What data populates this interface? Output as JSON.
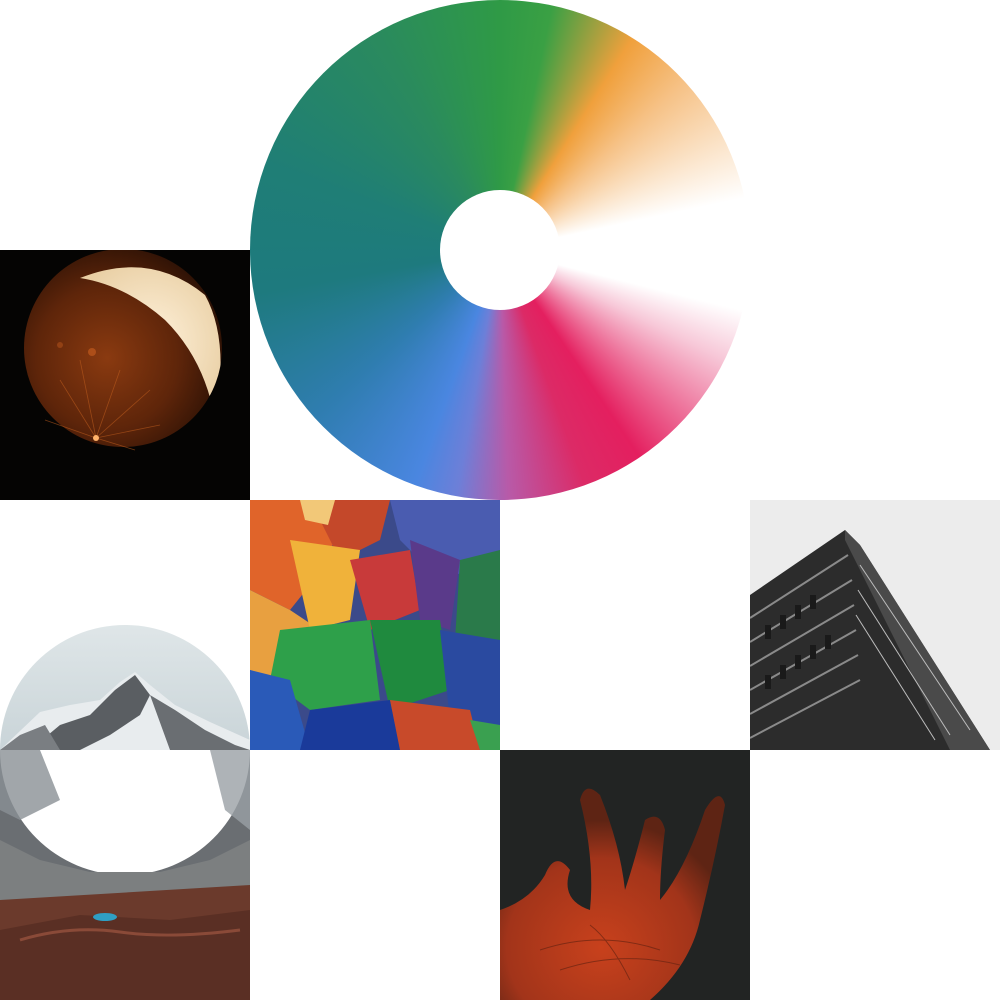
{
  "colors": {
    "background": "#ffffff",
    "moon_bg": "#050403",
    "hand_bg": "#222423",
    "building_sky": "#ececec"
  },
  "tiles": [
    {
      "name": "moon-eclipse-photo",
      "icon": "moon-eclipse-image"
    },
    {
      "name": "color-wheel-donut",
      "icon": "color-wheel-image"
    },
    {
      "name": "abstract-painting-photo",
      "icon": "abstract-painting-image"
    },
    {
      "name": "building-corner-photo",
      "icon": "building-image"
    },
    {
      "name": "mountain-landscape-photo",
      "icon": "mountain-image"
    },
    {
      "name": "red-hand-photo",
      "icon": "hand-image"
    }
  ]
}
